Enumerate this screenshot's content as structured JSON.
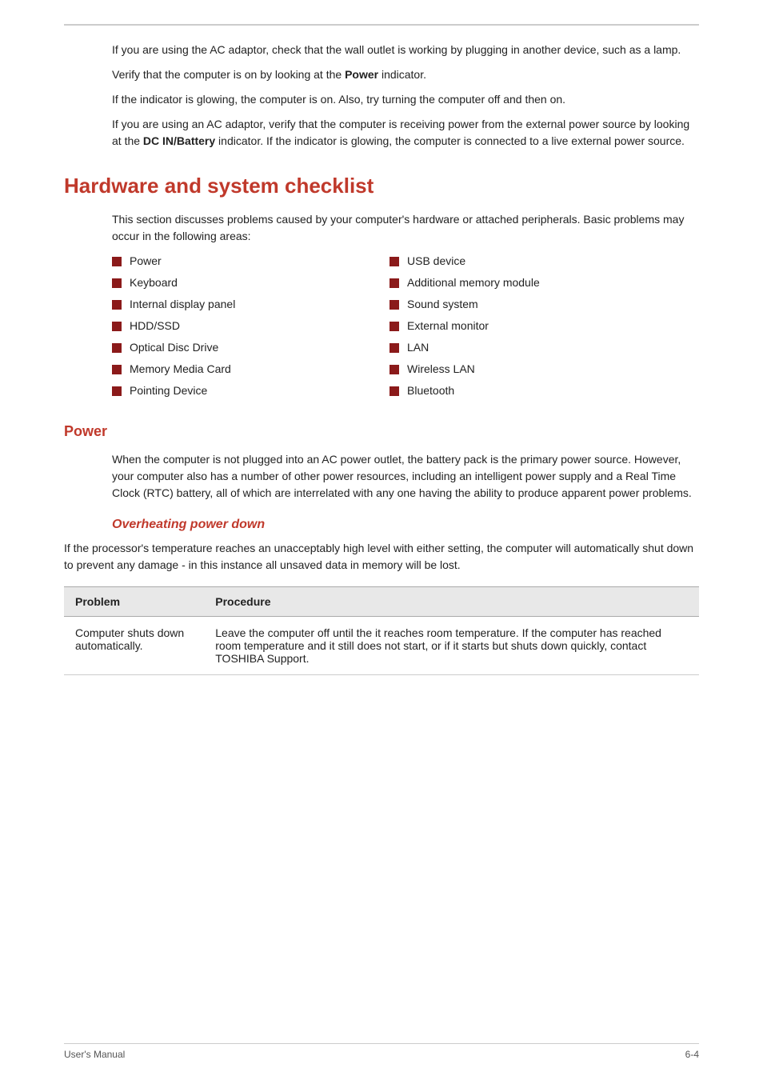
{
  "top_rule": true,
  "paragraphs": [
    "If you are using the AC adaptor, check that the wall outlet is working by plugging in another device, such as a lamp.",
    "Verify that the computer is on by looking at the <b>Power</b> indicator.",
    "If the indicator is glowing, the computer is on. Also, try turning the computer off and then on.",
    "If you are using an AC adaptor, verify that the computer is receiving power from the external power source by looking at the <b>DC IN/Battery</b> indicator. If the indicator is glowing, the computer is connected to a live external power source."
  ],
  "hardware_section": {
    "title": "Hardware and system checklist",
    "intro": "This section discusses problems caused by your computer's hardware or attached peripherals. Basic problems may occur in the following areas:",
    "checklist_left": [
      "Power",
      "Keyboard",
      "Internal display panel",
      "HDD/SSD",
      "Optical Disc Drive",
      "Memory Media Card",
      "Pointing Device"
    ],
    "checklist_right": [
      "USB device",
      "Additional memory module",
      "Sound system",
      "External monitor",
      "LAN",
      "Wireless LAN",
      "Bluetooth"
    ]
  },
  "power_section": {
    "title": "Power",
    "body": "When the computer is not plugged into an AC power outlet, the battery pack is the primary power source. However, your computer also has a number of other power resources, including an intelligent power supply and a Real Time Clock (RTC) battery, all of which are interrelated with any one having the ability to produce apparent power problems.",
    "subsection_title": "Overheating power down",
    "subsection_body": "If the processor's temperature reaches an unacceptably high level with either setting, the computer will automatically shut down to prevent any damage - in this instance all unsaved data in memory will be lost.",
    "table": {
      "col1_header": "Problem",
      "col2_header": "Procedure",
      "rows": [
        {
          "problem": "Computer shuts down automatically.",
          "procedure": "Leave the computer off until the it reaches room temperature. If the computer has reached room temperature and it still does not start, or if it starts but shuts down quickly, contact TOSHIBA Support."
        }
      ]
    }
  },
  "footer": {
    "left": "User's Manual",
    "right": "6-4"
  }
}
